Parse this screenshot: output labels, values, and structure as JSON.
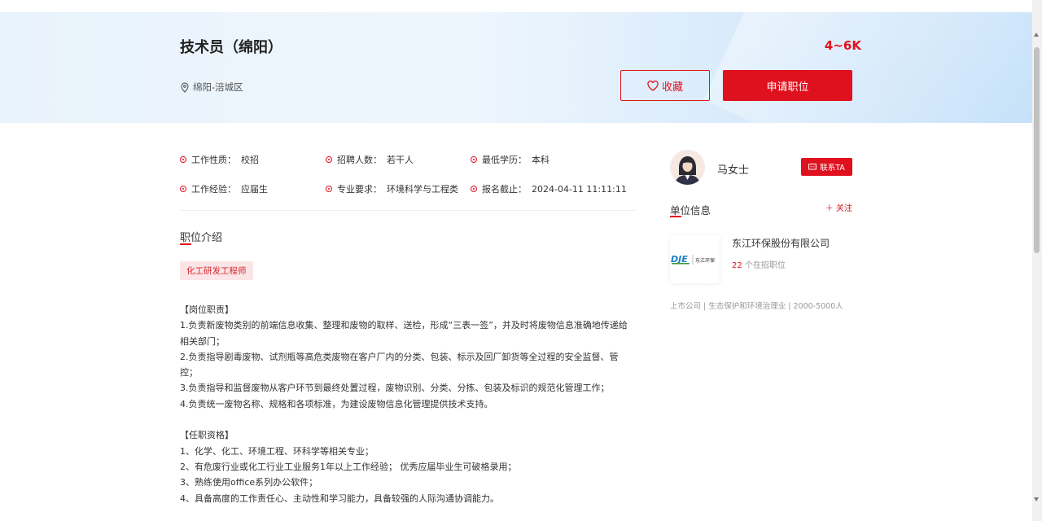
{
  "header": {
    "job_title": "技术员（绵阳）",
    "salary": "4~6K",
    "location": "绵阳-涪城区",
    "fav_label": "收藏",
    "apply_label": "申请职位"
  },
  "meta": [
    {
      "label": "工作性质：",
      "value": "校招"
    },
    {
      "label": "招聘人数：",
      "value": "若干人"
    },
    {
      "label": "最低学历：",
      "value": "本科"
    },
    {
      "label": "工作经验：",
      "value": "应届生"
    },
    {
      "label": "专业要求：",
      "value": "环境科学与工程类"
    },
    {
      "label": "报名截止：",
      "value": "2024-04-11 11:11:11"
    }
  ],
  "intro": {
    "section_title": "职位介绍",
    "tag": "化工研发工程师",
    "duties_title": "【岗位职责】",
    "duties": [
      "1.负责新废物类别的前端信息收集、整理和废物的取样、送检，形成“三表一签”，并及时将废物信息准确地传递给相关部门；",
      "2.负责指导剧毒废物、试剂瓶等高危类废物在客户厂内的分类、包装、标示及回厂卸货等全过程的安全监督、管控；",
      "3.负责指导和监督废物从客户环节到最终处置过程，废物识别、分类、分拣、包装及标识的规范化管理工作；",
      "4.负责统一废物名称、规格和各项标准，为建设废物信息化管理提供技术支持。"
    ],
    "req_title": "【任职资格】",
    "requirements": [
      "1、化学、化工、环境工程、环科学等相关专业；",
      "2、有危废行业或化工行业工业服务1年以上工作经验； 优秀应届毕业生可破格录用；",
      "3、熟练使用office系列办公软件；",
      "4、具备高度的工作责任心、主动性和学习能力，具备较强的人际沟通协调能力。"
    ]
  },
  "sidebar": {
    "recruiter_name": "马女士",
    "contact_label": "联系TA",
    "company_section": "单位信息",
    "follow_label": "＋ 关注",
    "company_name": "东江环保股份有限公司",
    "open_jobs_count": "22",
    "open_jobs_suffix": " 个在招职位",
    "company_meta": "上市公司 | 生态保护和环境治理业 | 2000-5000人",
    "logo_text": "东江环保"
  },
  "colors": {
    "accent": "#e0111e",
    "tag_bg": "#fbe5e6",
    "hero_start": "#e9f3fb",
    "hero_end": "#bcdcf8"
  }
}
